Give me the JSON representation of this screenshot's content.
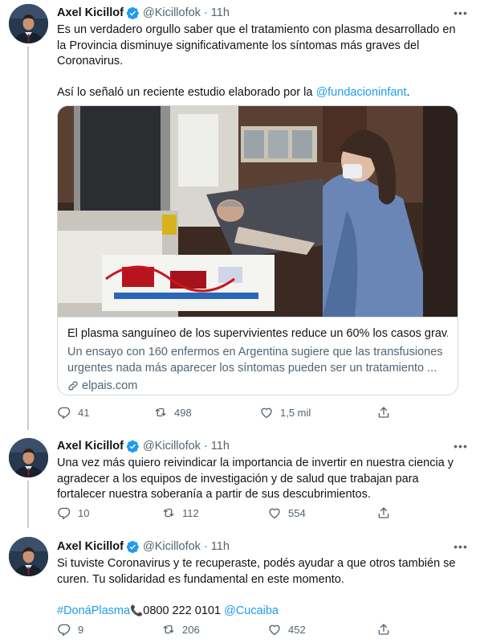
{
  "colors": {
    "link": "#1d9bf0",
    "secondary": "#536471",
    "verified": "#1d9bf0",
    "border": "#cfd9de"
  },
  "tweets": [
    {
      "name": "Axel Kicillof",
      "handle": "@Kicillofok",
      "separator": "·",
      "time": "11h",
      "text_line1": "Es un verdadero orgullo saber que el tratamiento con plasma desarrollado en la Provincia disminuye significativamente los síntomas más graves del Coronavirus.",
      "text_line2_prefix": "Así lo señaló un reciente estudio elaborado por la ",
      "text_line2_link": "@fundacioninfant",
      "text_line2_suffix": ".",
      "card": {
        "title": "El plasma sanguíneo de los supervivientes reduce un 60% los casos grav...",
        "description": "Un ensayo con 160 enfermos en Argentina sugiere que las transfusiones urgentes nada más aparecer los síntomas pueden ser un tratamiento ...",
        "domain": "elpais.com"
      },
      "actions": {
        "replies": "41",
        "retweets": "498",
        "likes": "1,5 mil"
      }
    },
    {
      "name": "Axel Kicillof",
      "handle": "@Kicillofok",
      "separator": "·",
      "time": "11h",
      "text": "Una vez más quiero reivindicar la importancia de invertir en nuestra ciencia y agradecer a los equipos de investigación y de salud que trabajan para fortalecer nuestra soberanía a partir de sus descubrimientos.",
      "actions": {
        "replies": "10",
        "retweets": "112",
        "likes": "554"
      }
    },
    {
      "name": "Axel Kicillof",
      "handle": "@Kicillofok",
      "separator": "·",
      "time": "11h",
      "text": "Si tuviste Coronavirus y te recuperaste, podés ayudar a que otros también se curen. Tu solidaridad es fundamental en este momento.",
      "hashtag": "#DonáPlasma",
      "phone_icon": "📞",
      "phone": "0800 222 0101",
      "mention": "@Cucaiba",
      "actions": {
        "replies": "9",
        "retweets": "206",
        "likes": "452"
      }
    }
  ]
}
